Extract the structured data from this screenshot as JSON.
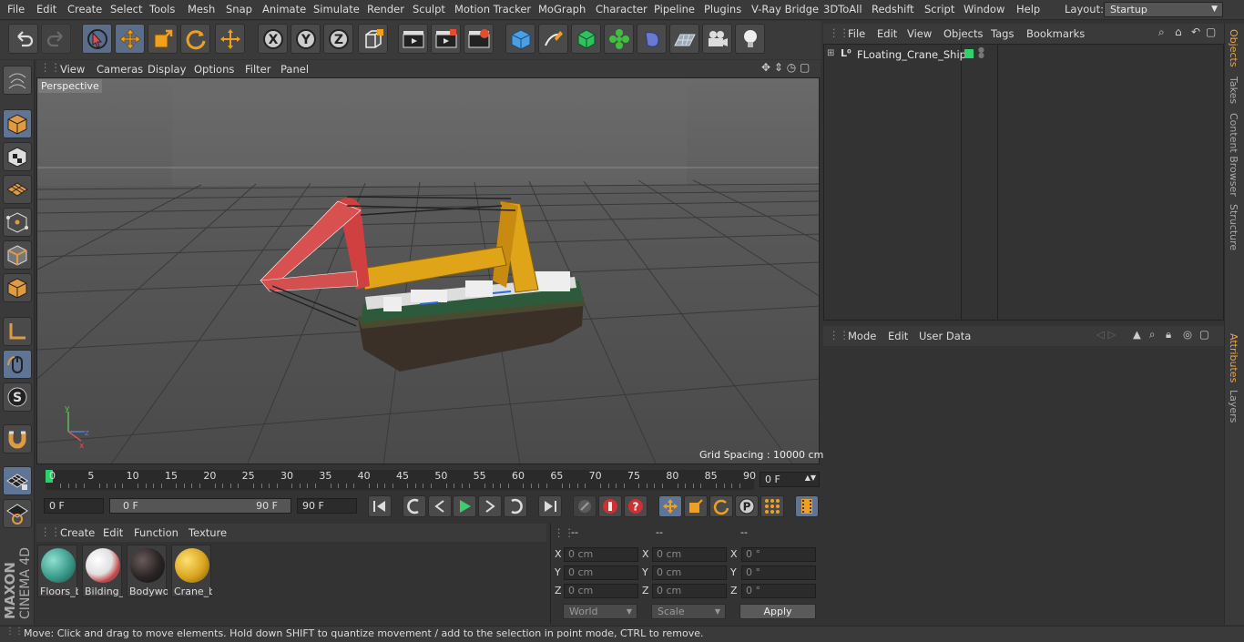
{
  "menubar": {
    "items": [
      "File",
      "Edit",
      "Create",
      "Select",
      "Tools",
      "Mesh",
      "Snap",
      "Animate",
      "Simulate",
      "Render",
      "Sculpt",
      "Motion Tracker",
      "MoGraph",
      "Character",
      "Pipeline",
      "Plugins",
      "V-Ray Bridge",
      "3DToAll",
      "Redshift",
      "Script",
      "Window",
      "Help"
    ],
    "layout_label": "Layout:",
    "layout_value": "Startup"
  },
  "toolbar": {
    "icons": [
      "undo-icon",
      "redo-icon",
      "live-selection-icon",
      "move-icon",
      "scale-icon",
      "rotate-icon",
      "transform-icon",
      "x-axis-icon",
      "y-axis-icon",
      "z-axis-icon",
      "world-coordinate-icon",
      "render-view-icon",
      "render-to-picture-viewer-icon",
      "edit-render-settings-icon",
      "cube-icon",
      "pen-icon",
      "subdivision-icon",
      "cloner-icon",
      "deformer-icon",
      "floor-icon",
      "camera-icon",
      "light-icon"
    ],
    "axes": [
      "X",
      "Y",
      "Z"
    ]
  },
  "viewport": {
    "menu": [
      "View",
      "Cameras",
      "Display",
      "Options",
      "Filter",
      "Panel"
    ],
    "label": "Perspective",
    "grid_spacing": "Grid Spacing : 10000 cm"
  },
  "timeline": {
    "ticks": [
      "0",
      "5",
      "10",
      "15",
      "20",
      "25",
      "30",
      "35",
      "40",
      "45",
      "50",
      "55",
      "60",
      "65",
      "70",
      "75",
      "80",
      "85",
      "90"
    ],
    "current_frame": "0 F",
    "start_field": "0 F",
    "range_start": "0 F",
    "range_end": "90 F",
    "end_field": "90 F"
  },
  "materials": {
    "menu": [
      "Create",
      "Edit",
      "Function",
      "Texture"
    ],
    "items": [
      {
        "name": "Floors_b",
        "color": "#3a9a8a"
      },
      {
        "name": "Bilding_",
        "color": "#e6e6e6"
      },
      {
        "name": "Bodywo",
        "color": "#2a2424"
      },
      {
        "name": "Crane_b",
        "color": "#d8a420"
      }
    ]
  },
  "coordinates": {
    "headers": [
      "--",
      "--",
      "--"
    ],
    "rows": [
      {
        "axis": "X",
        "pos": "0 cm",
        "size": "0 cm",
        "rot_axis": "X",
        "rot": "0 °"
      },
      {
        "axis": "Y",
        "pos": "0 cm",
        "size": "0 cm",
        "rot_axis": "Y",
        "rot": "0 °"
      },
      {
        "axis": "Z",
        "pos": "0 cm",
        "size": "0 cm",
        "rot_axis": "Z",
        "rot": "0 °"
      }
    ],
    "mode": "World",
    "scale": "Scale",
    "apply": "Apply"
  },
  "objects": {
    "menu": [
      "File",
      "Edit",
      "View",
      "Objects",
      "Tags",
      "Bookmarks"
    ],
    "tree": [
      {
        "name": "FLoating_Crane_Ship",
        "color": "#2ed36a"
      }
    ]
  },
  "attributes": {
    "menu": [
      "Mode",
      "Edit",
      "User Data"
    ]
  },
  "right_tabs": [
    "Objects",
    "Takes",
    "Content Browser",
    "Structure",
    "Attributes",
    "Layers"
  ],
  "status": "Move: Click and drag to move elements. Hold down SHIFT to quantize movement / add to the selection in point mode, CTRL to remove.",
  "logo": {
    "brand": "MAXON",
    "product": "CINEMA 4D"
  }
}
